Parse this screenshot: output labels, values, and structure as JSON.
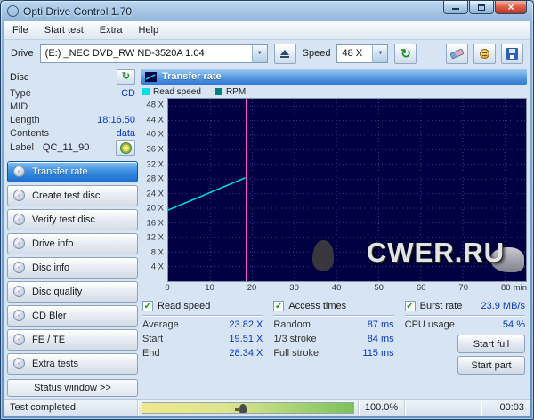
{
  "window": {
    "title": "Opti Drive Control 1.70"
  },
  "menu": {
    "items": [
      "File",
      "Start test",
      "Extra",
      "Help"
    ]
  },
  "toolbar": {
    "drive_label": "Drive",
    "drive_value": "(E:)  _NEC DVD_RW ND-3520A 1.04",
    "speed_label": "Speed",
    "speed_value": "48 X"
  },
  "sidebar": {
    "header": "Disc",
    "fields": [
      {
        "label": "Type",
        "value": "CD"
      },
      {
        "label": "MID",
        "value": ""
      },
      {
        "label": "Length",
        "value": "18:16.50"
      },
      {
        "label": "Contents",
        "value": "data"
      }
    ],
    "label_field": {
      "label": "Label",
      "value": "QC_11_90"
    },
    "nav": [
      "Transfer rate",
      "Create test disc",
      "Verify test disc",
      "Drive info",
      "Disc info",
      "Disc quality",
      "CD Bler",
      "FE / TE",
      "Extra tests"
    ],
    "active_nav": "Transfer rate",
    "status_button": "Status window >>"
  },
  "panel": {
    "title": "Transfer rate",
    "legend": [
      {
        "label": "Read speed",
        "color": "#00e0e6"
      },
      {
        "label": "RPM",
        "color": "#00807f"
      }
    ],
    "watermark": "CWER.RU"
  },
  "chart_data": {
    "type": "line",
    "title": "Transfer rate",
    "xlabel": "min",
    "ylabel": "Read speed (X)",
    "xlim": [
      0,
      85
    ],
    "ylim": [
      0,
      50
    ],
    "x_ticks": [
      0,
      10,
      20,
      30,
      40,
      50,
      60,
      70,
      80
    ],
    "x_unit": "min",
    "y_ticks": [
      4,
      8,
      12,
      16,
      20,
      24,
      28,
      32,
      36,
      40,
      44,
      48
    ],
    "y_unit": "X",
    "grid": true,
    "grid_color": "#3a3a94",
    "plot_bg": "#000042",
    "legend_position": "top-left",
    "series": [
      {
        "name": "Read speed",
        "color": "#00e0e6",
        "points": [
          [
            0,
            19.51
          ],
          [
            18.3,
            28.34
          ]
        ]
      },
      {
        "name": "RPM",
        "color": "#00807f",
        "points": []
      }
    ],
    "marker_x": 18.5,
    "marker_color": "#ff55cc"
  },
  "results": {
    "read_speed": {
      "title": "Read speed",
      "rows": [
        {
          "label": "Average",
          "value": "23.82 X"
        },
        {
          "label": "Start",
          "value": "19.51 X"
        },
        {
          "label": "End",
          "value": "28.34 X"
        }
      ]
    },
    "access_times": {
      "title": "Access times",
      "rows": [
        {
          "label": "Random",
          "value": "87 ms"
        },
        {
          "label": "1/3 stroke",
          "value": "84 ms"
        },
        {
          "label": "Full stroke",
          "value": "115 ms"
        }
      ]
    },
    "burst": {
      "title": "Burst rate",
      "value": "23.9 MB/s",
      "cpu_label": "CPU usage",
      "cpu_value": "54 %",
      "start_full": "Start full",
      "start_part": "Start part"
    }
  },
  "statusbar": {
    "message": "Test completed",
    "progress_percent": 100.0,
    "progress_text": "100.0%",
    "time": "00:03"
  }
}
